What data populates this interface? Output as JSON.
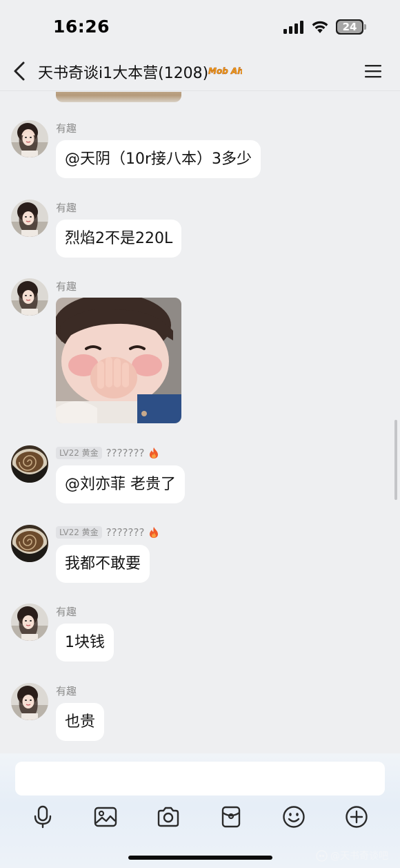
{
  "status_bar": {
    "time": "16:26",
    "battery_level": "24"
  },
  "header": {
    "title": "天书奇谈i1大本营(1208)",
    "badge_text": "Mob Ahe"
  },
  "messages": [
    {
      "type": "text",
      "sender": "有趣",
      "avatar": "girl-photo-avatar",
      "text": "@天阴（10r接八本）3多少"
    },
    {
      "type": "text",
      "sender": "有趣",
      "avatar": "girl-photo-avatar",
      "text": "烈焰2不是220L"
    },
    {
      "type": "sticker",
      "sender": "有趣",
      "avatar": "girl-photo-avatar",
      "sticker": "baby-covering-mouth-sticker"
    },
    {
      "type": "text",
      "sender": "???????",
      "level": "LV22 黄金",
      "avatar": "coffee-cup-avatar",
      "text": "@刘亦菲 老贵了"
    },
    {
      "type": "text",
      "sender": "???????",
      "level": "LV22 黄金",
      "avatar": "coffee-cup-avatar",
      "text": "我都不敢要"
    },
    {
      "type": "text",
      "sender": "有趣",
      "avatar": "girl-photo-avatar",
      "text": "1块钱"
    },
    {
      "type": "text",
      "sender": "有趣",
      "avatar": "girl-photo-avatar",
      "text": "也贵"
    }
  ],
  "composer": {
    "input_value": "",
    "tools": [
      "microphone-icon",
      "image-icon",
      "camera-icon",
      "red-packet-icon",
      "emoji-icon",
      "plus-icon"
    ]
  },
  "watermark": "@天书奇谈吧",
  "colors": {
    "background": "#eeeff1",
    "bubble": "#ffffff",
    "fire": "#f05a28"
  }
}
